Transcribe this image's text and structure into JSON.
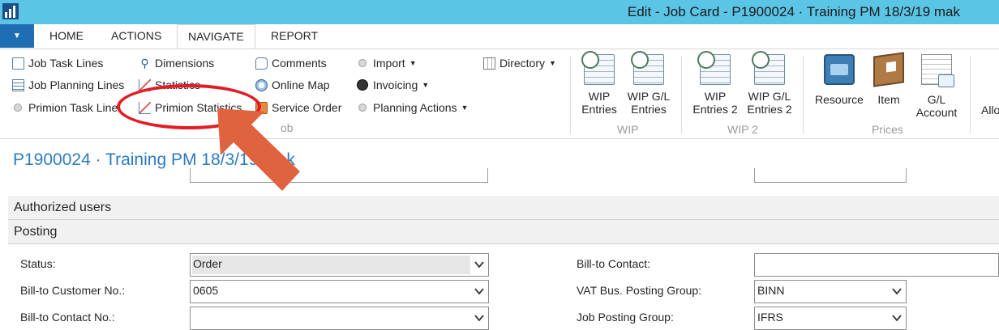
{
  "window": {
    "title": "Edit - Job Card - P1900024 · Training PM 18/3/19 mak"
  },
  "tabs": {
    "app_menu_symbol": "▼",
    "items": [
      "HOME",
      "ACTIONS",
      "NAVIGATE",
      "REPORT"
    ],
    "active": "NAVIGATE"
  },
  "ribbon": {
    "job_group": {
      "job_task_lines": "Job Task Lines",
      "job_planning_lines": "Job Planning Lines",
      "primion_task_line": "Primion Task Line",
      "dimensions": "Dimensions",
      "statistics": "Statistics",
      "primion_statistics": "Primion Statistics",
      "comments": "Comments",
      "online_map": "Online Map",
      "service_order": "Service Order",
      "import": "Import",
      "invoicing": "Invoicing",
      "planning_actions": "Planning Actions",
      "directory": "Directory",
      "group_label_visible": "ob"
    },
    "wip_group": {
      "wip_entries": "WIP Entries",
      "wip_gl_entries": "WIP G/L Entries",
      "label": "WIP"
    },
    "wip2_group": {
      "wip_entries_2": "WIP Entries 2",
      "wip_gl_entries_2": "WIP G/L Entries 2",
      "label": "WIP 2"
    },
    "prices_group": {
      "resource": "Resource",
      "item": "Item",
      "gl_account": "G/L Account",
      "label": "Prices"
    },
    "truncated_next": "Allo"
  },
  "page": {
    "title": "P1900024 · Training PM 18/3/19 mak"
  },
  "sections": {
    "authorized_users": "Authorized users",
    "posting": "Posting"
  },
  "posting": {
    "status_label": "Status:",
    "status_value": "Order",
    "bill_to_customer_no_label": "Bill-to Customer No.:",
    "bill_to_customer_no_value": "0605",
    "bill_to_contact_no_label": "Bill-to Contact No.:",
    "bill_to_contact_no_value": "",
    "bill_to_contact_label": "Bill-to Contact:",
    "bill_to_contact_value": "",
    "vat_bus_posting_group_label": "VAT Bus. Posting Group:",
    "vat_bus_posting_group_value": "BINN",
    "job_posting_group_label": "Job Posting Group:",
    "job_posting_group_value": "IFRS"
  },
  "colors": {
    "titlebar": "#5bc5e6",
    "accent": "#1f6eb3",
    "page_title": "#2d7bbf",
    "annotation": "#e31b23",
    "arrow": "#e0633f"
  }
}
